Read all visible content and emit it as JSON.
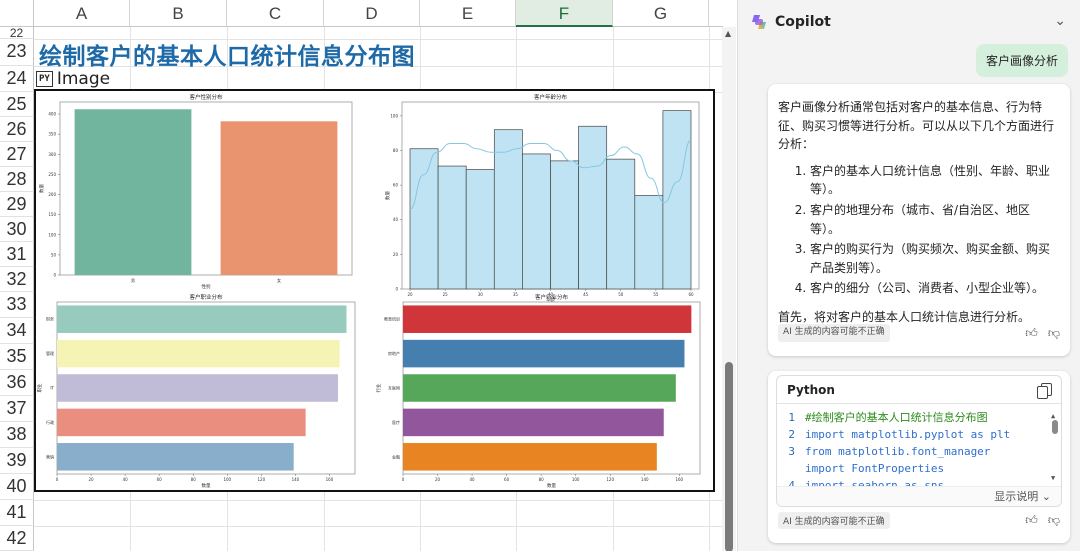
{
  "sheet": {
    "columns": [
      "A",
      "B",
      "C",
      "D",
      "E",
      "F",
      "G"
    ],
    "selected_column": "F",
    "rows": [
      "22",
      "23",
      "24",
      "25",
      "26",
      "27",
      "28",
      "29",
      "30",
      "31",
      "32",
      "33",
      "34",
      "35",
      "36",
      "37",
      "38",
      "39",
      "40",
      "41",
      "42"
    ],
    "title_cell": "绘制客户的基本人口统计信息分布图",
    "image_badge": "PY",
    "image_label": "Image"
  },
  "chart_data": [
    {
      "type": "bar",
      "title": "客户性别分布",
      "xlabel": "性别",
      "ylabel": "数量",
      "categories": [
        "男",
        "女"
      ],
      "values": [
        412,
        382
      ],
      "yticks": [
        0,
        50,
        100,
        150,
        200,
        250,
        300,
        350,
        400
      ],
      "ylim": [
        0,
        430
      ],
      "colors": [
        "#72b59f",
        "#e9946f"
      ]
    },
    {
      "type": "histogram",
      "title": "客户年龄分布",
      "xlabel": "年龄",
      "ylabel": "数量",
      "bin_edges": [
        20,
        22.2,
        24.4,
        26.6,
        28.8,
        31,
        33.2,
        35.4,
        37.6,
        39.8,
        42
      ],
      "values": [
        81,
        71,
        69,
        92,
        78,
        74,
        94,
        75,
        54,
        103
      ],
      "xticks": [
        20,
        25,
        30,
        35,
        40,
        45,
        50,
        55,
        60
      ],
      "xtick_labels": [
        "20",
        "25",
        "30",
        "35",
        "40",
        "45",
        "50",
        "55",
        "60"
      ],
      "yticks": [
        0,
        20,
        40,
        60,
        80,
        100
      ],
      "ylim": [
        0,
        108
      ],
      "kde": [
        46,
        66,
        79,
        84,
        84,
        81,
        79,
        79,
        81,
        84,
        84,
        80,
        74,
        70,
        71,
        77,
        82,
        78,
        64,
        50,
        62,
        86
      ],
      "bar_color": "#bfe3f2",
      "kde_color": "#86c7e3"
    },
    {
      "type": "bar_horizontal",
      "title": "客户职业分布",
      "xlabel": "数量",
      "ylabel": "职业",
      "categories": [
        "财务",
        "管理",
        "IT",
        "行政",
        "营销"
      ],
      "values": [
        170,
        166,
        165,
        146,
        139
      ],
      "xticks": [
        0,
        20,
        40,
        60,
        80,
        100,
        120,
        140,
        160
      ],
      "xlim": [
        0,
        175
      ],
      "colors": [
        "#97cbbd",
        "#f6f4b5",
        "#c0bcd8",
        "#ea8e80",
        "#88aecb"
      ]
    },
    {
      "type": "bar_horizontal",
      "title": "客户行业分布",
      "xlabel": "数量",
      "ylabel": "行业",
      "categories": [
        "教育培训",
        "房地产",
        "互联网",
        "医疗",
        "金融"
      ],
      "values": [
        167,
        163,
        158,
        151,
        147
      ],
      "xticks": [
        0,
        20,
        40,
        60,
        80,
        100,
        120,
        140,
        160
      ],
      "xlim": [
        0,
        172
      ],
      "colors": [
        "#d03539",
        "#447fb0",
        "#57a75a",
        "#92569d",
        "#e88421"
      ]
    }
  ],
  "copilot": {
    "title": "Copilot",
    "user_message": "客户画像分析",
    "answer_intro": "客户画像分析通常包括对客户的基本信息、行为特征、购买习惯等进行分析。可以从以下几个方面进行分析：",
    "answer_items": [
      "客户的基本人口统计信息（性别、年龄、职业等）。",
      "客户的地理分布（城市、省/自治区、地区等）。",
      "客户的购买行为（购买频次、购买金额、购买产品类别等）。",
      "客户的细分（公司、消费者、小型企业等）。"
    ],
    "answer_outro": "首先，将对客户的基本人口统计信息进行分析。",
    "ai_note": "AI 生成的内容可能不正确",
    "code_language": "Python",
    "code_lines": [
      {
        "no": "1",
        "kind": "comment",
        "text": "#绘制客户的基本人口统计信息分布图"
      },
      {
        "no": "2",
        "kind": "import",
        "text": "import matplotlib.pyplot as plt"
      },
      {
        "no": "3",
        "kind": "import",
        "text": "from matplotlib.font_manager"
      },
      {
        "no": "",
        "kind": "import",
        "text": "import FontProperties"
      },
      {
        "no": "4",
        "kind": "import",
        "text": "import seaborn as sns"
      }
    ],
    "show_explanation": "显示说明",
    "ai_note_2": "AI 生成的内容可能不正确",
    "accent_color": "#d4efdc"
  }
}
